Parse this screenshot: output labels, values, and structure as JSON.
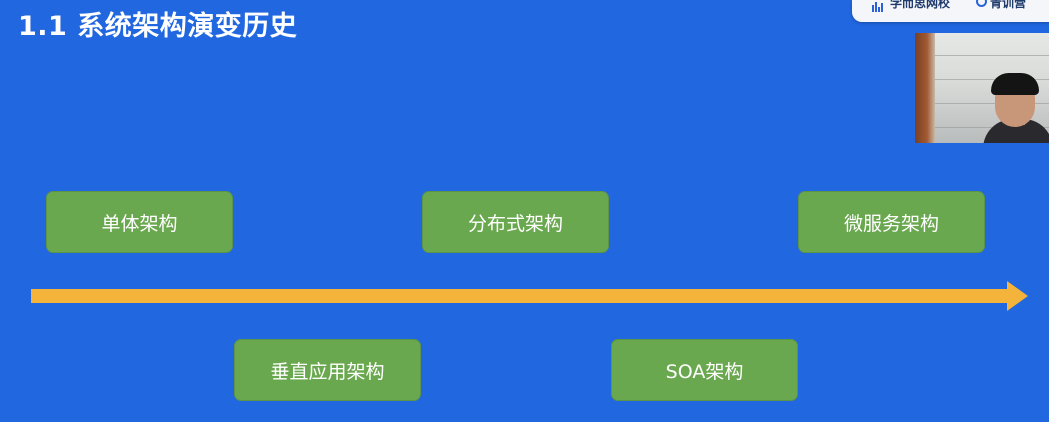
{
  "slide": {
    "title": "1.1 系统架构演变历史"
  },
  "logo_bar": {
    "brand_1": "学而思网校",
    "brand_2": "青训营"
  },
  "timeline": {
    "above": [
      {
        "label": "单体架构"
      },
      {
        "label": "分布式架构"
      },
      {
        "label": "微服务架构"
      }
    ],
    "below": [
      {
        "label": "垂直应用架构"
      },
      {
        "label": "SOA架构"
      }
    ]
  },
  "colors": {
    "background": "#2167e0",
    "box_fill": "#6aa84f",
    "arrow": "#f4b33b",
    "text": "#ffffff"
  },
  "icons": {
    "logo": "logo-icon",
    "arrow": "arrow-right-icon"
  }
}
